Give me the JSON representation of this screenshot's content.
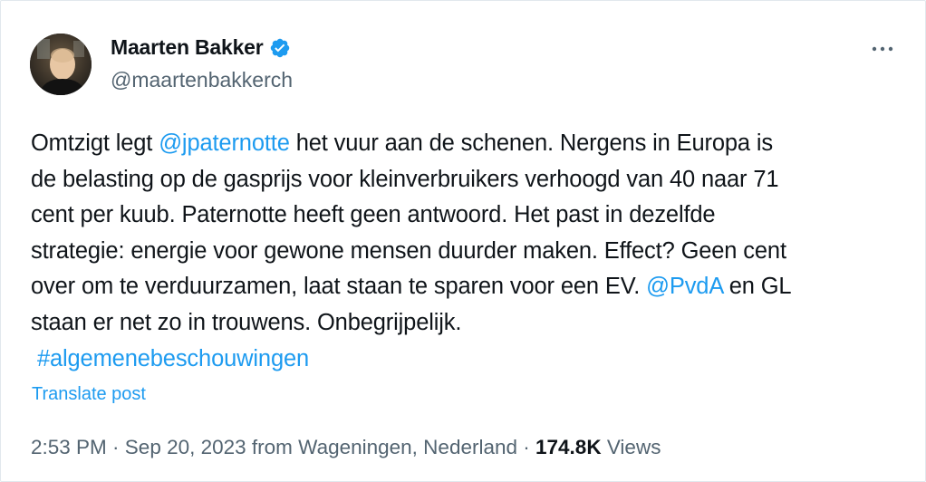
{
  "author": {
    "display_name": "Maarten Bakker",
    "handle": "@maartenbakkerch",
    "verified": true,
    "verified_color": "#1d9bf0"
  },
  "tweet": {
    "segments": [
      {
        "text": "Omtzigt legt ",
        "type": "text"
      },
      {
        "text": "@jpaternotte",
        "type": "mention"
      },
      {
        "text": " het vuur aan de schenen. Nergens in Europa is\nde belasting op de gasprijs voor kleinverbruikers verhoogd van 40 naar 71\ncent per kuub. Paternotte heeft geen antwoord. Het past in dezelfde\nstrategie: energie voor gewone mensen duurder maken. Effect? Geen cent\nover om te verduurzamen, laat staan te sparen voor een EV. ",
        "type": "text"
      },
      {
        "text": "@PvdA",
        "type": "mention"
      },
      {
        "text": " en GL\nstaan er net zo in trouwens. Onbegrijpelijk.\n ",
        "type": "text"
      },
      {
        "text": "#algemenebeschouwingen",
        "type": "hashtag"
      }
    ],
    "translate_label": "Translate post"
  },
  "meta": {
    "time": "2:53 PM",
    "sep1": " · ",
    "date": "Sep 20, 2023",
    "location": " from Wageningen, Nederland",
    "sep2": " · ",
    "views_count": "174.8K",
    "views_label": " Views"
  },
  "colors": {
    "link": "#1d9bf0",
    "text": "#0f1419",
    "secondary": "#536471"
  },
  "icons": {
    "verified": "verified-badge-icon",
    "more": "more-options-icon"
  }
}
